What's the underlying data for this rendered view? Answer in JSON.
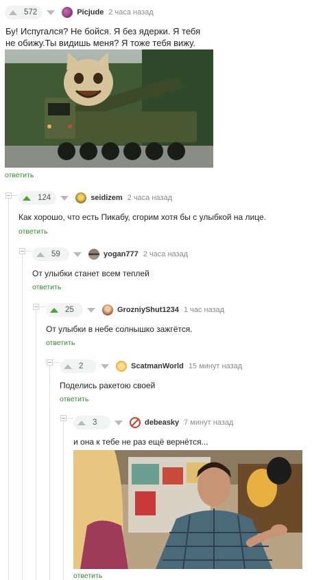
{
  "comments": [
    {
      "rating": "572",
      "user": "Picjude",
      "time": "2 часа назад",
      "text": "Бу! Испугался? Не бойся. Я без ядерки. Я тебя не обижу.Ты видишь меня? Я тоже тебя вижу.",
      "reply": "ответить",
      "upvoted": false,
      "avatar_color": "#7b3c8c"
    },
    {
      "rating": "124",
      "user": "seidizem",
      "time": "2 часа назад",
      "text": "Как хорошо, что есть Пикабу, сгорим хотя бы с улыбкой на лице.",
      "reply": "ответить",
      "upvoted": true,
      "avatar_color": "#c8a23a"
    },
    {
      "rating": "59",
      "user": "yogan777",
      "time": "2 часа назад",
      "text": "От улыбки станет всем теплей",
      "reply": "ответить",
      "upvoted": false,
      "avatar_color": "#6a6255"
    },
    {
      "rating": "25",
      "user": "GrozniyShut1234",
      "time": "1 час назад",
      "text": "От улыбки в небе солнышко зажгётся.",
      "reply": "ответить",
      "upvoted": true,
      "avatar_color": "#b3805a"
    },
    {
      "rating": "2",
      "user": "ScatmanWorld",
      "time": "15 минут назад",
      "text": "Поделись ракетою своей",
      "reply": "ответить",
      "upvoted": false,
      "avatar_color": "#e8b640"
    },
    {
      "rating": "3",
      "user": "debeasky",
      "time": "7 минут назад",
      "text": "и она к тебе не раз ещё вернётся...",
      "reply": "ответить",
      "upvoted": false,
      "avatar_color": "#d23a2a"
    }
  ]
}
